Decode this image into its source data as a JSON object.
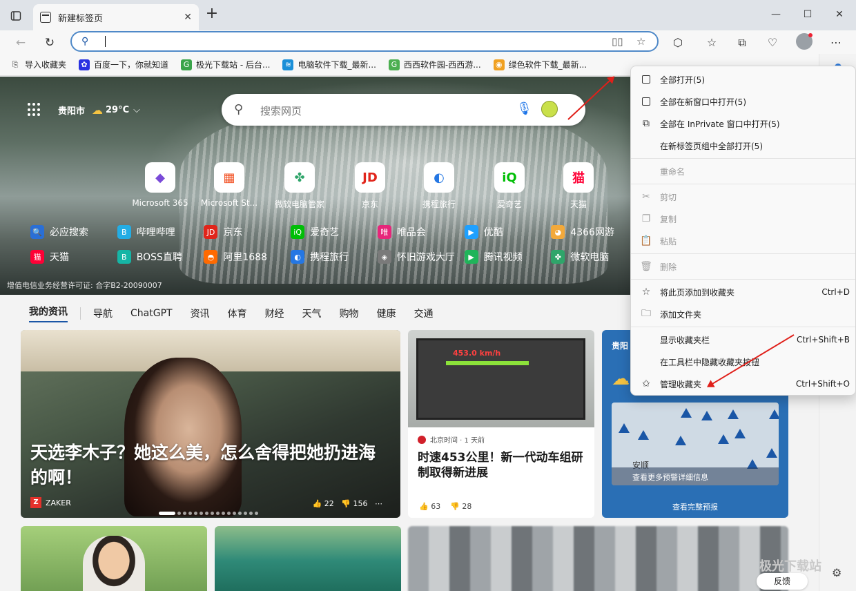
{
  "tab": {
    "title": "新建标签页",
    "close": "✕"
  },
  "window_controls": {
    "minimize": "—",
    "maximize": "☐",
    "close": "✕"
  },
  "favorites_bar": [
    {
      "label": "导入收藏夹",
      "color": "#555555",
      "glyph": "⎘"
    },
    {
      "label": "百度一下，你就知道",
      "color": "#2932e1",
      "glyph": "✿"
    },
    {
      "label": "极光下载站 - 后台...",
      "color": "#3aa44a",
      "glyph": "G"
    },
    {
      "label": "电脑软件下载_最新...",
      "color": "#1a8fd8",
      "glyph": "≋"
    },
    {
      "label": "西西软件园-西西游...",
      "color": "#4caf50",
      "glyph": "G"
    },
    {
      "label": "绿色软件下载_最新...",
      "color": "#f0a020",
      "glyph": "◉"
    }
  ],
  "hero": {
    "city": "贵阳市",
    "temp": "29°C",
    "search_placeholder": "搜索网页",
    "license": "增值电信业务经营许可证: 合字B2-20090007"
  },
  "quick_links": [
    {
      "label": "Microsoft 365",
      "glyph": "◆",
      "color": "#7a4ad8"
    },
    {
      "label": "Microsoft St...",
      "glyph": "▦",
      "color": "#f25022"
    },
    {
      "label": "微软电脑管家",
      "glyph": "✤",
      "color": "#2fa56a"
    },
    {
      "label": "京东",
      "glyph": "JD",
      "color": "#e1251b"
    },
    {
      "label": "携程旅行",
      "glyph": "◐",
      "color": "#2577e3"
    },
    {
      "label": "爱奇艺",
      "glyph": "iQ",
      "color": "#00be06"
    },
    {
      "label": "天猫",
      "glyph": "猫",
      "color": "#ff0036"
    }
  ],
  "links_row1": [
    {
      "label": "必应搜索",
      "glyph": "🔍",
      "color": "#2a6fd6"
    },
    {
      "label": "哔哩哔哩",
      "glyph": "B",
      "color": "#23ade5"
    },
    {
      "label": "京东",
      "glyph": "JD",
      "color": "#e1251b"
    },
    {
      "label": "爱奇艺",
      "glyph": "iQ",
      "color": "#00be06"
    },
    {
      "label": "唯品会",
      "glyph": "唯",
      "color": "#e6267a"
    },
    {
      "label": "优酷",
      "glyph": "▶",
      "color": "#1ea0ff"
    },
    {
      "label": "4366网游",
      "glyph": "◕",
      "color": "#f2a93b"
    }
  ],
  "links_row2": [
    {
      "label": "天猫",
      "glyph": "猫",
      "color": "#ff0036"
    },
    {
      "label": "BOSS直聘",
      "glyph": "B",
      "color": "#16b5a5"
    },
    {
      "label": "阿里1688",
      "glyph": "◓",
      "color": "#ff6a00"
    },
    {
      "label": "携程旅行",
      "glyph": "◐",
      "color": "#2577e3"
    },
    {
      "label": "怀旧游戏大厅",
      "glyph": "◈",
      "color": "#7a7a7a"
    },
    {
      "label": "腾讯视频",
      "glyph": "▶",
      "color": "#20b45a"
    },
    {
      "label": "微软电脑",
      "glyph": "✤",
      "color": "#2fa56a"
    }
  ],
  "feed_nav": [
    "我的资讯",
    "导航",
    "ChatGPT",
    "资讯",
    "体育",
    "财经",
    "天气",
    "购物",
    "健康",
    "交通"
  ],
  "cards": {
    "main": {
      "headline": "天选李木子？她这么美，怎么舍得把她扔进海的啊！",
      "source": "ZAKER",
      "likes": "👍 22",
      "dislikes": "👎 156"
    },
    "train": {
      "speed": "453.0 km/h",
      "meta": "北京时间 · 1 天前",
      "headline": "时速453公里！新一代动车组研制取得新进展",
      "likes": "👍 63",
      "dislikes": "👎 28"
    },
    "weather": {
      "city": "贵阳",
      "map_place": "安顺",
      "more": "查看更多预警详细信息",
      "full": "查看完整预报"
    }
  },
  "feedback": "反馈",
  "context_menu": [
    {
      "label": "全部打开(5)",
      "icon": "open-all-icon",
      "glyph": "sq",
      "shortcut": "",
      "disabled": false
    },
    {
      "label": "全部在新窗口中打开(5)",
      "icon": "new-window-icon",
      "glyph": "sq",
      "shortcut": "",
      "disabled": false
    },
    {
      "label": "全部在 InPrivate 窗口中打开(5)",
      "icon": "inprivate-icon",
      "glyph": "⧉",
      "shortcut": "",
      "disabled": false
    },
    {
      "label": "在新标签页组中全部打开(5)",
      "icon": "",
      "glyph": "",
      "shortcut": "",
      "disabled": false
    },
    {
      "divider": true
    },
    {
      "label": "重命名",
      "icon": "",
      "glyph": "",
      "shortcut": "",
      "disabled": true
    },
    {
      "divider": true
    },
    {
      "label": "剪切",
      "icon": "scissors-icon",
      "glyph": "✂",
      "shortcut": "",
      "disabled": true
    },
    {
      "label": "复制",
      "icon": "copy-icon",
      "glyph": "❐",
      "shortcut": "",
      "disabled": true
    },
    {
      "label": "粘贴",
      "icon": "paste-icon",
      "glyph": "📋",
      "shortcut": "",
      "disabled": true
    },
    {
      "divider": true
    },
    {
      "label": "删除",
      "icon": "trash-icon",
      "glyph": "🗑",
      "shortcut": "",
      "disabled": true
    },
    {
      "divider": true
    },
    {
      "label": "将此页添加到收藏夹",
      "icon": "add-favorite-icon",
      "glyph": "☆",
      "shortcut": "Ctrl+D",
      "disabled": false
    },
    {
      "label": "添加文件夹",
      "icon": "add-folder-icon",
      "glyph": "🗀",
      "shortcut": "",
      "disabled": false
    },
    {
      "divider": true
    },
    {
      "label": "显示收藏夹栏",
      "icon": "",
      "glyph": "",
      "shortcut": "Ctrl+Shift+B",
      "disabled": false
    },
    {
      "label": "在工具栏中隐藏收藏夹按钮",
      "icon": "",
      "glyph": "",
      "shortcut": "",
      "disabled": false
    },
    {
      "label": "管理收藏夹",
      "icon": "manage-favorites-icon",
      "glyph": "✩",
      "shortcut": "Ctrl+Shift+O",
      "disabled": false
    }
  ],
  "watermark": "极光下载站"
}
